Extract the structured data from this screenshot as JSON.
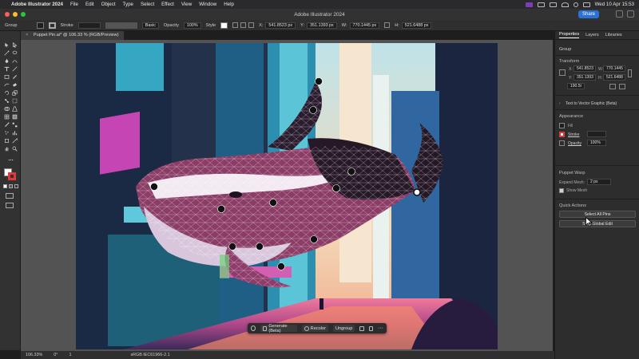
{
  "menubar": {
    "app_name": "Adobe Illustrator 2024",
    "items": [
      "File",
      "Edit",
      "Object",
      "Type",
      "Select",
      "Effect",
      "View",
      "Window",
      "Help"
    ],
    "clock": "Wed 10 Apr  15:53"
  },
  "titlebar": {
    "title": "Adobe Illustrator 2024",
    "share_label": "Share"
  },
  "controlbar": {
    "selection": "Group",
    "stroke_label": "Stroke",
    "brush": "Basic",
    "opacity_label": "Opacity",
    "opacity": "100%",
    "style_label": "Style",
    "x_label": "X:",
    "x": "541.8523 px",
    "y_label": "Y:",
    "y": "351.1393 px",
    "w_label": "W:",
    "w": "770.1445 px",
    "h_label": "H:",
    "h": "521.6488 px"
  },
  "document": {
    "tab_title": "Puppet Pin.ai* @ 106.33 % (RGB/Preview)"
  },
  "taskbar": {
    "generate_label": "Generate (Beta)",
    "recolor_label": "Recolor",
    "ungroup_label": "Ungroup"
  },
  "statusbar": {
    "zoom": "106.33%",
    "rotation": "0°",
    "artboard": "1",
    "profile": "sRGB IEC61966-2.1"
  },
  "panel": {
    "tabs": [
      "Properties",
      "Layers",
      "Libraries"
    ],
    "selection_type": "Group",
    "transform": {
      "title": "Transform",
      "x_label": "X:",
      "x": "541.8523",
      "y_label": "Y:",
      "y": "351.1393",
      "w_label": "W:",
      "w": "770.1445",
      "h_label": "H:",
      "h": "521.6488",
      "angle": "190.5t"
    },
    "text_to_vector": "Text to Vector Graphic (Beta)",
    "appearance": {
      "title": "Appearance",
      "fill_label": "Fill",
      "stroke_label": "Stroke",
      "opacity_label": "Opacity",
      "opacity": "100%"
    },
    "puppet_warp": {
      "title": "Puppet Warp",
      "expand_label": "Expand Mesh:",
      "expand_value": "2 px",
      "show_mesh_label": "Show Mesh"
    },
    "quick_actions": {
      "title": "Quick Actions",
      "select_all_pins": "Select All Pins",
      "start_global_edit": "Start Global Edit"
    }
  }
}
